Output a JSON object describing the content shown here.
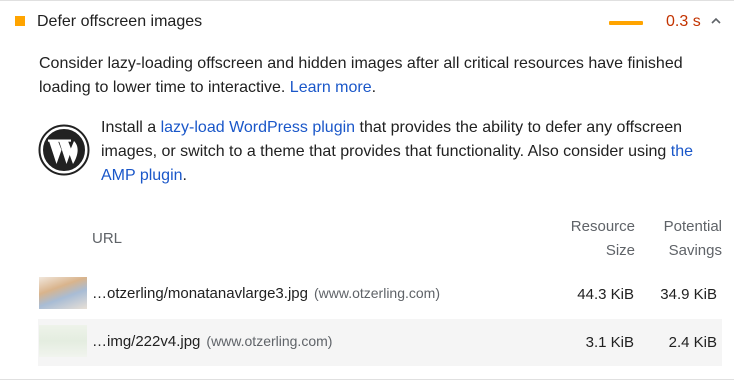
{
  "audit": {
    "title": "Defer offscreen images",
    "savings": "0.3 s",
    "status_color": "#ffa400",
    "savings_color": "#c33300",
    "icons": [
      "severity-square",
      "chevron-up-icon",
      "wordpress-logo-icon"
    ]
  },
  "description": {
    "text_1": "Consider lazy-loading offscreen and hidden images after all critical resources have finished loading to lower time to interactive. ",
    "link": "Learn more",
    "text_2": "."
  },
  "stack_pack": {
    "text_1": "Install a ",
    "link_1": "lazy-load WordPress plugin",
    "text_2": " that provides the ability to defer any offscreen images, or switch to a theme that provides that functionality. Also consider using ",
    "link_2": "the AMP plugin",
    "text_3": "."
  },
  "table": {
    "headers": {
      "url": "URL",
      "size_line1": "Resource",
      "size_line2": "Size",
      "savings_line1": "Potential",
      "savings_line2": "Savings"
    },
    "rows": [
      {
        "url": "…otzerling/monatanavlarge3.jpg",
        "host": "(www.otzerling.com)",
        "size": "44.3 KiB",
        "savings": "34.9 KiB"
      },
      {
        "url": "…img/222v4.jpg",
        "host": "(www.otzerling.com)",
        "size": "3.1 KiB",
        "savings": "2.4 KiB"
      }
    ]
  },
  "colors": {
    "link": "#1a57c9",
    "muted": "#5f6368",
    "row_alt": "#f5f5f5"
  }
}
